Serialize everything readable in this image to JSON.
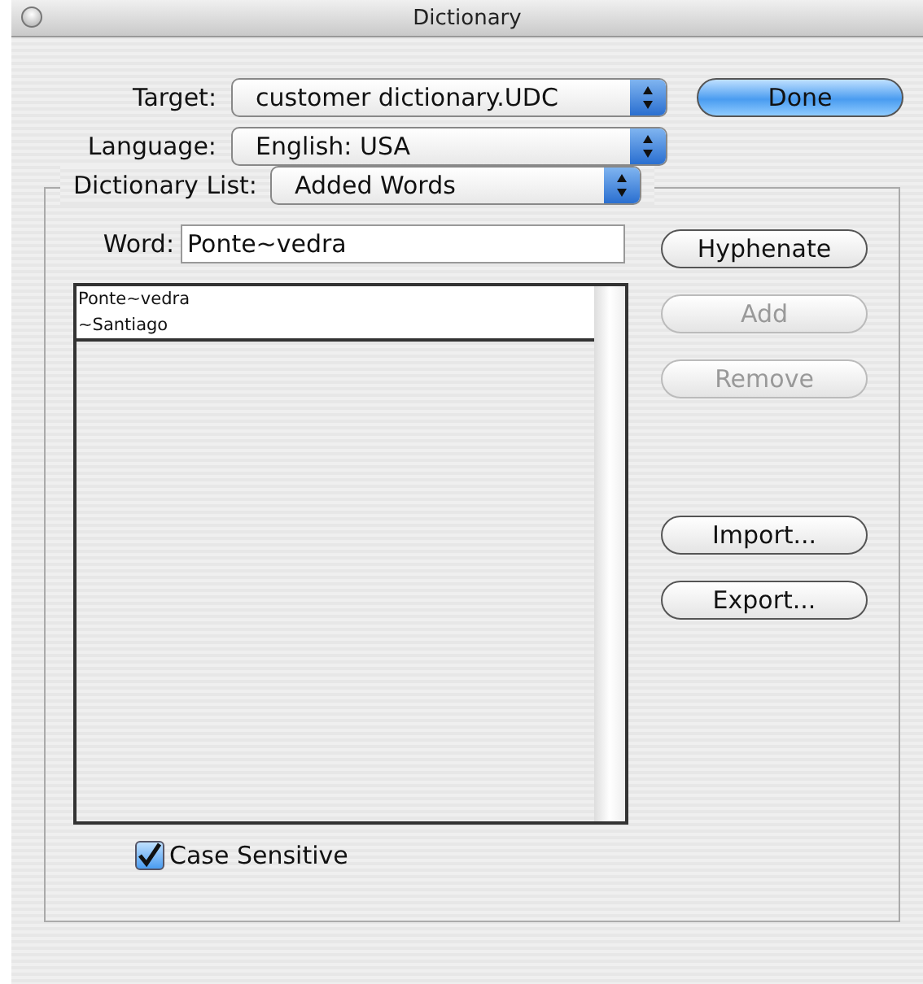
{
  "window": {
    "title": "Dictionary"
  },
  "target": {
    "label": "Target:",
    "value": "customer dictionary.UDC"
  },
  "language": {
    "label": "Language:",
    "value": "English: USA"
  },
  "done_button": {
    "label": "Done",
    "kind": "default"
  },
  "dictionary_list": {
    "label": "Dictionary List:",
    "value": "Added Words"
  },
  "word": {
    "label": "Word:",
    "value": "Ponte~vedra"
  },
  "entries": [
    "Ponte~vedra",
    "~Santiago"
  ],
  "edit_buttons": [
    {
      "label": "Hyphenate",
      "disabled": false
    },
    {
      "label": "Add",
      "disabled": true
    },
    {
      "label": "Remove",
      "disabled": true
    }
  ],
  "file_buttons": [
    {
      "label": "Import...",
      "disabled": false
    },
    {
      "label": "Export...",
      "disabled": false
    }
  ],
  "case_sensitive": {
    "label": "Case Sensitive",
    "checked": true
  }
}
